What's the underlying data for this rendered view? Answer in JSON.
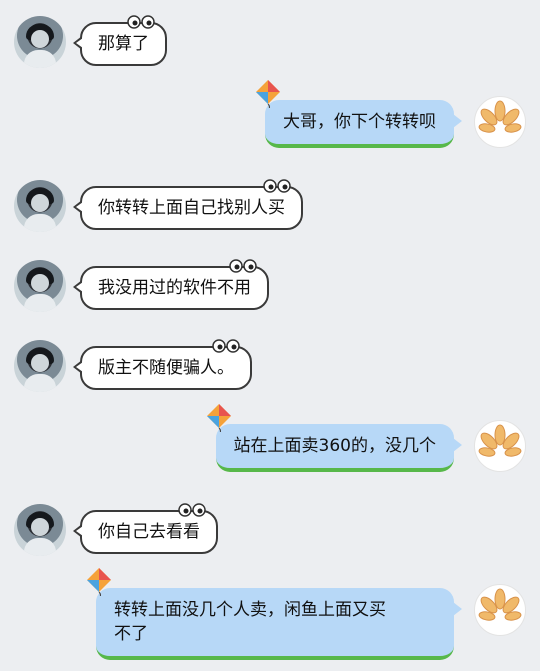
{
  "messages": [
    {
      "side": "left",
      "text": "那算了"
    },
    {
      "side": "right",
      "text": "大哥，你下个转转呗"
    },
    {
      "side": "left",
      "text": "你转转上面自己找别人买"
    },
    {
      "side": "left",
      "text": "我没用过的软件不用"
    },
    {
      "side": "left",
      "text": "版主不随便骗人。"
    },
    {
      "side": "right",
      "text": "站在上面卖360的，没几个"
    },
    {
      "side": "left",
      "text": "你自己去看看"
    },
    {
      "side": "right",
      "text": "转转上面没几个人卖，闲鱼上面又买\n不了"
    }
  ],
  "icons": {
    "bubble_decor_in": "cartoon-eyes-icon",
    "bubble_decor_out": "kite-icon",
    "avatar_left": "user-avatar-photo",
    "avatar_right": "golden-logo-avatar"
  },
  "colors": {
    "background": "#eceef1",
    "incoming_bubble": "#ffffff",
    "outgoing_bubble": "#b7d8f7",
    "outgoing_accent": "#57b84a"
  }
}
